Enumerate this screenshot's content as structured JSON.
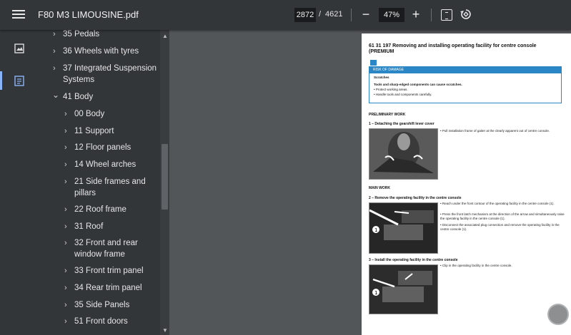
{
  "toolbar": {
    "title": "F80 M3 LIMOUSINE.pdf",
    "page_current": "2872",
    "page_separator": "/",
    "page_total": "4621",
    "zoom_out": "−",
    "zoom_value": "47%",
    "zoom_in": "+"
  },
  "outline": {
    "items": [
      {
        "label": "35 Pedals",
        "arrow": "›"
      },
      {
        "label": "36 Wheels with tyres",
        "arrow": "›"
      },
      {
        "label": "37 Integrated Suspension",
        "label2": "Systems",
        "arrow": "›"
      },
      {
        "label": "41 Body",
        "arrow": "⌄"
      },
      {
        "label": "00 Body",
        "arrow": "›"
      },
      {
        "label": "11 Support",
        "arrow": "›"
      },
      {
        "label": "12 Floor panels",
        "arrow": "›"
      },
      {
        "label": "14 Wheel arches",
        "arrow": "›"
      },
      {
        "label": "21 Side frames and",
        "label2": "pillars",
        "arrow": "›"
      },
      {
        "label": "22 Roof frame",
        "arrow": "›"
      },
      {
        "label": "31 Roof",
        "arrow": "›"
      },
      {
        "label": "32 Front and rear",
        "label2": "window frame",
        "arrow": "›"
      },
      {
        "label": "33 Front trim panel",
        "arrow": "›"
      },
      {
        "label": "34 Rear trim panel",
        "arrow": "›"
      },
      {
        "label": "35 Side Panels",
        "arrow": "›"
      },
      {
        "label": "51 Front doors",
        "arrow": "›"
      }
    ]
  },
  "doc": {
    "heading": "61 31 197  Removing and installing operating facility for centre console (PREMIUM",
    "warn_title": "RISK OF DAMAGE",
    "warn_sub": "Scratches",
    "warn_line1": "Tools and sharp-edged components can cause scratches.",
    "warn_line2": "• Protect working areas.",
    "warn_line3": "• Handle tools and components carefully.",
    "prelim": "PRELIMINARY WORK",
    "step1": "1 – Detaching the gearshift lever cover",
    "step1_b1": "• Pull installation frame of gaiter at the clearly apparent out of centre console.",
    "main": "MAIN WORK",
    "step2": "2 – Remove the operating facility in the centre console",
    "step2_b1": "• Reach under the front contour of the operating facility in the centre console (1).",
    "step2_b2": "• Press the front latch mechanism at the direction of the arrow and simultaneously raise the operating facility in the centre console (1).",
    "step2_b3": "• Disconnect the associated plug connection and remove the operating facility in the centre console (1).",
    "step3": "3 – Install the operating facility in the centre console",
    "step3_b1": "• Clip in the operating facility in the centre console."
  }
}
